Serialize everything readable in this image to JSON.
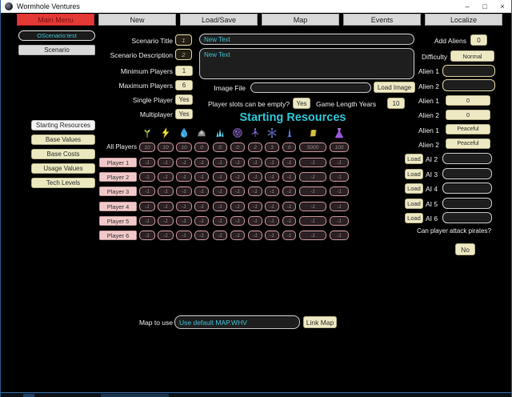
{
  "window": {
    "title": "Wormhole Ventures",
    "controls": {
      "minimize": "–",
      "maximize": "□",
      "close": "×"
    }
  },
  "menu": {
    "items": [
      {
        "label": "Main Menu",
        "active": true
      },
      {
        "label": "New"
      },
      {
        "label": "Load/Save"
      },
      {
        "label": "Map"
      },
      {
        "label": "Events"
      },
      {
        "label": "Localize"
      }
    ]
  },
  "left": {
    "scenario_id": "OScenario:test",
    "scenario": "Scenario",
    "sections": [
      {
        "label": "Starting Resources",
        "active": true
      },
      {
        "label": "Base Values"
      },
      {
        "label": "Base Costs"
      },
      {
        "label": "Usage Values"
      },
      {
        "label": "Tech Levels"
      }
    ]
  },
  "form": {
    "scenario_title_label": "Scenario Title",
    "scenario_title_index": "1",
    "scenario_title_value": "New Text",
    "scenario_description_label": "Scenario Description",
    "scenario_description_index": "2",
    "scenario_description_value": "New Text",
    "minimum_players_label": "Minimum Players",
    "minimum_players_value": "1",
    "maximum_players_label": "Maximum Players",
    "maximum_players_value": "6",
    "single_player_label": "Single Player",
    "single_player_value": "Yes",
    "multiplayer_label": "Multiplayer",
    "multiplayer_value": "Yes",
    "image_file_label": "Image File",
    "image_file_value": "",
    "load_image_button": "Load Image",
    "player_slots_label": "Player slots can be empty?",
    "player_slots_value": "Yes",
    "game_length_label": "Game Length Years",
    "game_length_value": "10"
  },
  "resources": {
    "heading": "Starting Resources",
    "columns": [
      "plant",
      "lightning",
      "water-drop",
      "rock",
      "crystal",
      "orb",
      "probe",
      "snowflake-ship",
      "rocket",
      "money",
      "flask"
    ],
    "all_players_label": "All Players",
    "all_players_values": [
      "10",
      "10",
      "10",
      "0",
      "0",
      "0",
      "2",
      "3",
      "0",
      "5000",
      "100"
    ],
    "rows": [
      {
        "label": "Player 1",
        "values": [
          "-1",
          "-1",
          "-1",
          "-1",
          "-1",
          "-1",
          "-1",
          "-1",
          "-1",
          "-1",
          "-1"
        ]
      },
      {
        "label": "Player 2",
        "values": [
          "-1",
          "-1",
          "-1",
          "-1",
          "-1",
          "-1",
          "-1",
          "-1",
          "-1",
          "-1",
          "-1"
        ]
      },
      {
        "label": "Player 3",
        "values": [
          "-1",
          "-1",
          "-1",
          "-1",
          "-1",
          "-1",
          "-1",
          "-1",
          "-1",
          "-1",
          "-1"
        ]
      },
      {
        "label": "Player 4",
        "values": [
          "-1",
          "-1",
          "-1",
          "-1",
          "-1",
          "-1",
          "-1",
          "-1",
          "-1",
          "-1",
          "-1"
        ]
      },
      {
        "label": "Player 5",
        "values": [
          "-1",
          "-1",
          "-1",
          "-1",
          "-1",
          "-1",
          "-1",
          "-1",
          "-1",
          "-1",
          "-1"
        ]
      },
      {
        "label": "Player 6",
        "values": [
          "-1",
          "-1",
          "-1",
          "-1",
          "-1",
          "-1",
          "-1",
          "-1",
          "-1",
          "-1",
          "-1"
        ]
      }
    ]
  },
  "aliens": {
    "add_aliens_label": "Add Aliens",
    "add_aliens_value": "0",
    "difficulty_label": "Difficulty",
    "difficulty_value": "Normal",
    "alien1_name_label": "Alien 1",
    "alien1_name_value": "",
    "alien2_name_label": "Alien 2",
    "alien2_name_value": "",
    "alien1_count_label": "Alien 1",
    "alien1_count_value": "0",
    "alien2_count_label": "Alien 2",
    "alien2_count_value": "0",
    "alien1_mood_label": "Alien 1",
    "alien1_mood_value": "Peaceful",
    "alien2_mood_label": "Alien 2",
    "alien2_mood_value": "Peaceful"
  },
  "ai": {
    "rows": [
      {
        "button": "Load",
        "label": "AI 2",
        "value": ""
      },
      {
        "button": "Load",
        "label": "AI 3",
        "value": ""
      },
      {
        "button": "Load",
        "label": "AI 4",
        "value": ""
      },
      {
        "button": "Load",
        "label": "AI 5",
        "value": ""
      },
      {
        "button": "Load",
        "label": "AI 6",
        "value": ""
      }
    ]
  },
  "pirates": {
    "question": "Can player attack pirates?",
    "answer": "No"
  },
  "map": {
    "label": "Map to use",
    "value": "Use default MAP.WHV",
    "button": "Link Map"
  },
  "colors": {
    "accent_cyan": "#3fc1d4",
    "menu_red": "#e53935",
    "tan_button": "#eee9c3",
    "pink_button": "#f2c9c9",
    "cell_border": "#c9959b",
    "heading_cyan": "#29c5d6"
  }
}
